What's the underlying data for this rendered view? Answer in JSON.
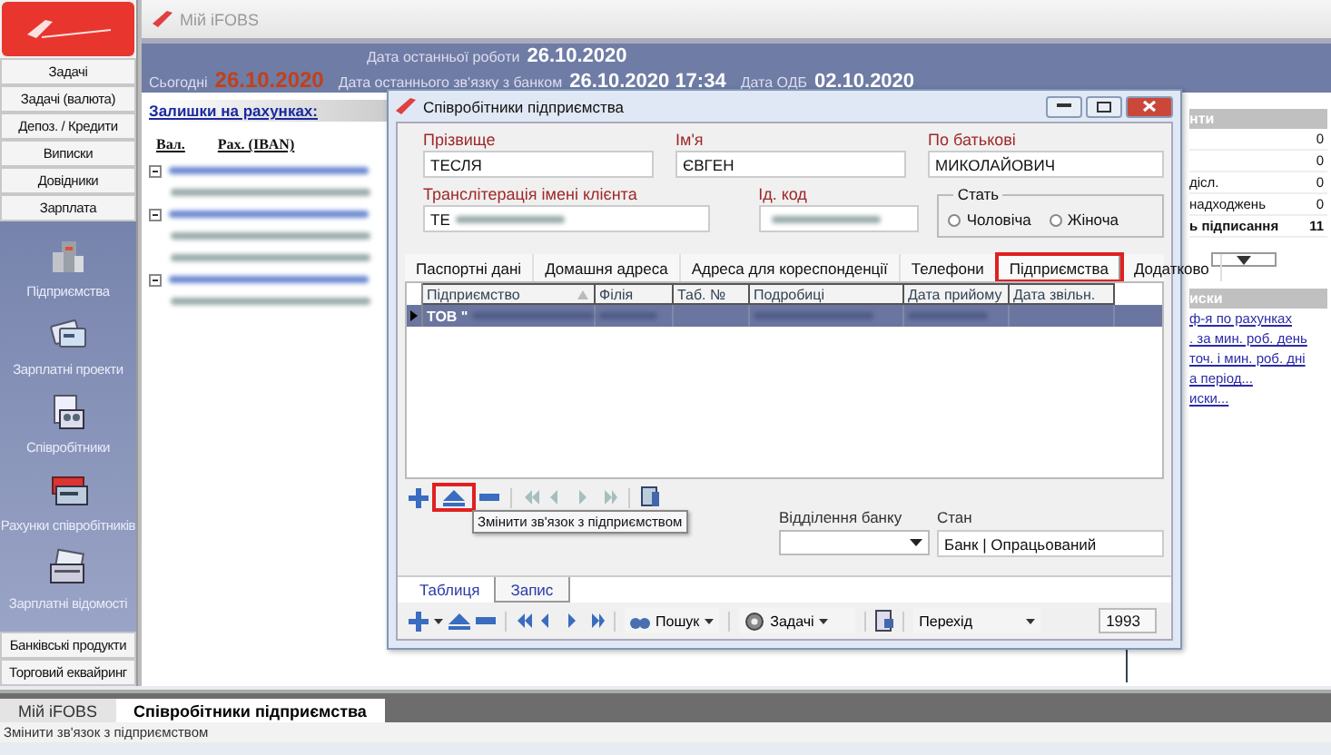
{
  "sidebar": {
    "menu_top": [
      "Задачі",
      "Задачі (валюта)",
      "Депоз. / Кредити",
      "Виписки",
      "Довідники",
      "Зарплата"
    ],
    "panel_items": [
      {
        "label": "Підприємства",
        "kind": "building"
      },
      {
        "label": "Зарплатні проекти",
        "kind": "cards"
      },
      {
        "label": "Співробітники",
        "kind": "employees"
      },
      {
        "label": "Рахунки співробітників",
        "kind": "accounts"
      },
      {
        "label": "Зарплатні відомості",
        "kind": "statements"
      }
    ],
    "menu_bottom": [
      "Банківські продукти",
      "Торговий еквайринг"
    ]
  },
  "main_window": {
    "title": "Мій iFOBS"
  },
  "header": {
    "last_work_label": "Дата останньої роботи",
    "last_work_date": "26.10.2020",
    "today_label": "Сьогодні",
    "today_date": "26.10.2020",
    "last_link_label": "Дата останнього зв'язку з банком",
    "last_link_value": "26.10.2020 17:34",
    "odb_label": "Дата ОДБ",
    "odb_value": "02.10.2020"
  },
  "balances": {
    "title": "Залишки на рахунках:",
    "columns": [
      "Вал.",
      "Рах. (IBAN)"
    ],
    "groups": [
      {
        "expanded": true,
        "accounts": [
          {
            "redacted": true
          }
        ]
      },
      {
        "expanded": true,
        "accounts": [
          {
            "redacted": true
          },
          {
            "redacted": true
          }
        ]
      },
      {
        "expanded": true,
        "accounts": [
          {
            "redacted": true
          }
        ]
      }
    ]
  },
  "documents": {
    "title": "нти",
    "rows": [
      {
        "count": "0",
        "bold": false
      },
      {
        "count": "0",
        "bold": false
      },
      {
        "label": "дісл.",
        "count": "0",
        "bold": false
      },
      {
        "label": "надходжень",
        "count": "0",
        "bold": false
      },
      {
        "label": "ь підписання",
        "count": "11",
        "bold": true
      }
    ]
  },
  "statements": {
    "title": "иски",
    "links": [
      "ф-я по рахунках",
      ". за мин. роб. день",
      "точ. і мин. роб. дні",
      "а період...",
      "иски..."
    ]
  },
  "dialog": {
    "title": "Співробітники підприємства",
    "fields": [
      {
        "label": "Прізвище",
        "value": "ТЕСЛЯ",
        "redacted": false
      },
      {
        "label": "Ім'я",
        "value": "ЄВГЕН",
        "redacted": false
      },
      {
        "label": "По батькові",
        "value": "МИКОЛАЙОВИЧ",
        "redacted": false
      },
      {
        "label": "Транслітерація імені клієнта",
        "value": "ТЕ",
        "redacted": true
      },
      {
        "label": "Ід. код",
        "redacted": true
      }
    ],
    "gender": {
      "label": "Стать",
      "options": [
        {
          "label": "Чоловіча",
          "selected": false
        },
        {
          "label": "Жіноча",
          "selected": false
        }
      ]
    },
    "tabs": [
      {
        "label": "Паспортні дані",
        "selected": false
      },
      {
        "label": "Домашня адреса",
        "selected": false
      },
      {
        "label": "Адреса для кореспонденції",
        "selected": false
      },
      {
        "label": "Телефони",
        "selected": false
      },
      {
        "label": "Підприємства",
        "selected": true,
        "highlighted": true
      },
      {
        "label": "Додатково",
        "selected": false
      }
    ],
    "grid": {
      "columns": [
        {
          "label": "Підприємство",
          "sorted": true
        },
        {
          "label": "Філія",
          "sorted": false
        },
        {
          "label": "Таб. №",
          "sorted": false
        },
        {
          "label": "Подробиці",
          "sorted": false
        },
        {
          "label": "Дата прийому",
          "sorted": false
        },
        {
          "label": "Дата звільн.",
          "sorted": false
        }
      ],
      "rows": [
        {
          "selected": true,
          "cells": [
            {
              "text": "ТОВ \"",
              "redacted": true
            },
            {
              "redacted": true
            },
            {
              "redacted": false
            },
            {
              "redacted": true
            },
            {
              "redacted": true
            },
            {
              "redacted": false
            }
          ]
        }
      ]
    },
    "grid_toolbar": {
      "edit_highlighted": true,
      "nav_disabled": true,
      "tooltip": "Змінити зв'язок з підприємством"
    },
    "bank_branch": {
      "label": "Відділення банку"
    },
    "state": {
      "label": "Стан",
      "value": "Банк | Опрацьований"
    },
    "view_tabs": [
      {
        "label": "Таблиця",
        "selected": false
      },
      {
        "label": "Запис",
        "selected": true
      }
    ],
    "bottom_toolbar": {
      "search": "Пошук",
      "tasks": "Задачі",
      "goto": "Перехід",
      "record": "1993"
    }
  },
  "taskbar": [
    {
      "label": "Мій iFOBS",
      "selected": false
    },
    {
      "label": "Співробітники підприємства",
      "selected": true
    }
  ],
  "status_bar": "Змінити зв'язок з підприємством"
}
